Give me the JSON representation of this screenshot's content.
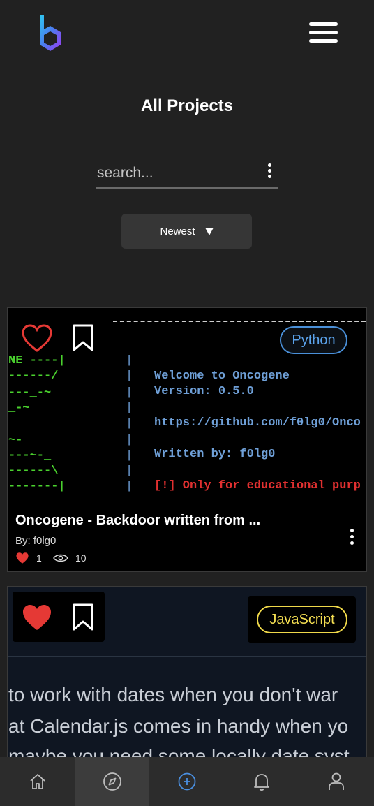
{
  "header": {
    "logo_icon": "hexagon-b-logo-icon",
    "menu_icon": "hamburger-menu-icon"
  },
  "page": {
    "title": "All Projects"
  },
  "search": {
    "placeholder": "search...",
    "value": ""
  },
  "sort": {
    "selected": "Newest"
  },
  "projects": [
    {
      "title": "Oncogene - Backdoor written from ...",
      "author": "By: f0lg0",
      "tag": "Python",
      "likes": "1",
      "views": "10",
      "liked": false,
      "colors": {
        "tag": "#4a90d9",
        "like": "#e53935"
      },
      "thumbnail": {
        "left_lines": [
          "NE ----|",
          "------/",
          "---_-~",
          "_-~",
          "~-_",
          "---~-_",
          "------\\",
          "-------|"
        ],
        "lines": [
          "Welcome to Oncogene",
          "Version: 0.5.0",
          "https://github.com/f0lg0/Onco",
          "Written by: f0lg0",
          "[!] Only for educational purp"
        ]
      }
    },
    {
      "tag": "JavaScript",
      "liked": true,
      "colors": {
        "tag": "#f0d94a",
        "like": "#e53935"
      },
      "thumbnail": {
        "lines": [
          "to work with dates when you don't war",
          "at Calendar.js comes in handy when yo",
          "maybe you need some locally date syst"
        ]
      }
    }
  ],
  "bottom_nav": [
    {
      "icon": "home-icon",
      "active": false
    },
    {
      "icon": "compass-icon",
      "active": true
    },
    {
      "icon": "add-circle-icon",
      "active": false
    },
    {
      "icon": "bell-icon",
      "active": false
    },
    {
      "icon": "user-icon",
      "active": false
    }
  ],
  "colors": {
    "background": "#212121",
    "nav_background": "#2c2c2c",
    "accent_blue": "#4a8fe0"
  }
}
